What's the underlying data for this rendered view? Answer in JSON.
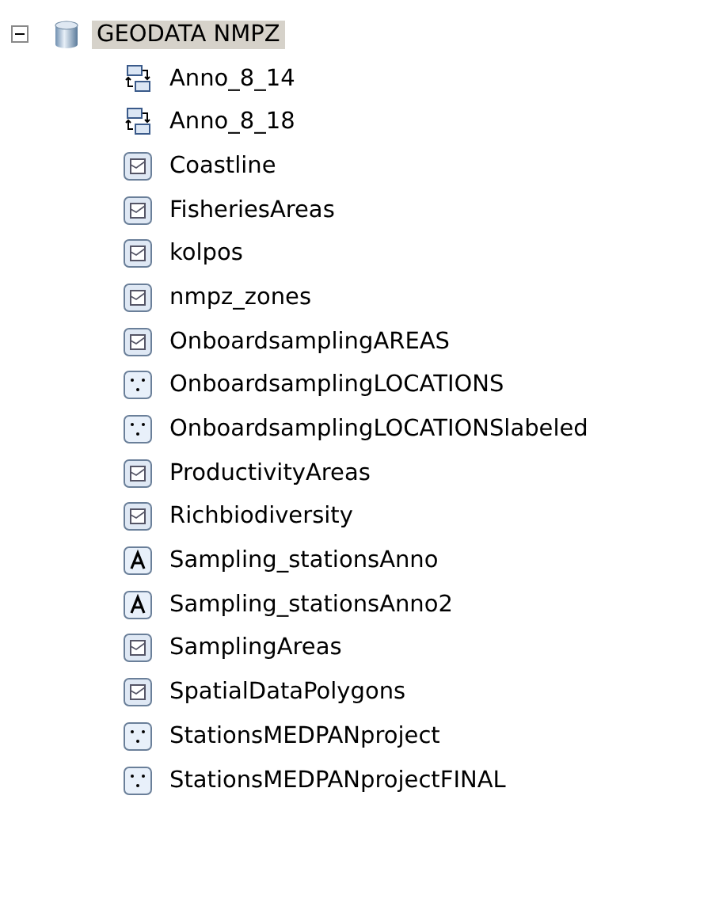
{
  "tree": {
    "label": "GEODATA NMPZ",
    "expanded": true,
    "selected": true,
    "children": [
      {
        "label": "Anno_8_14",
        "kind": "relationship",
        "selected": false
      },
      {
        "label": "Anno_8_18",
        "kind": "relationship",
        "selected": false
      },
      {
        "label": "Coastline",
        "kind": "polygon",
        "selected": false
      },
      {
        "label": "FisheriesAreas",
        "kind": "polygon",
        "selected": false
      },
      {
        "label": "kolpos",
        "kind": "polygon",
        "selected": false
      },
      {
        "label": "nmpz_zones",
        "kind": "polygon",
        "selected": false
      },
      {
        "label": "OnboardsamplingAREAS",
        "kind": "polygon",
        "selected": false
      },
      {
        "label": "OnboardsamplingLOCATIONS",
        "kind": "point",
        "selected": false
      },
      {
        "label": "OnboardsamplingLOCATIONSlabeled",
        "kind": "point",
        "selected": false
      },
      {
        "label": "ProductivityAreas",
        "kind": "polygon",
        "selected": false
      },
      {
        "label": "Richbiodiversity",
        "kind": "polygon",
        "selected": false
      },
      {
        "label": "Sampling_stationsAnno",
        "kind": "annotation",
        "selected": false
      },
      {
        "label": "Sampling_stationsAnno2",
        "kind": "annotation",
        "selected": false
      },
      {
        "label": "SamplingAreas",
        "kind": "polygon",
        "selected": false
      },
      {
        "label": "SpatialDataPolygons",
        "kind": "polygon",
        "selected": false
      },
      {
        "label": "StationsMEDPANproject",
        "kind": "point",
        "selected": false
      },
      {
        "label": "StationsMEDPANprojectFINAL",
        "kind": "point",
        "selected": false
      }
    ]
  }
}
